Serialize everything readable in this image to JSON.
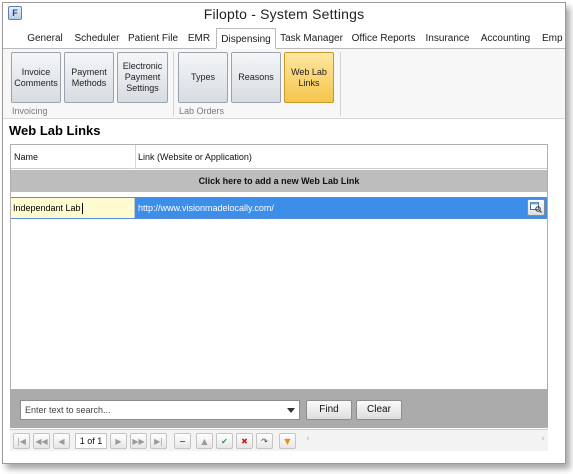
{
  "window": {
    "title": "Filopto - System Settings"
  },
  "tabs": [
    {
      "label": "General"
    },
    {
      "label": "Scheduler"
    },
    {
      "label": "Patient File"
    },
    {
      "label": "EMR"
    },
    {
      "label": "Dispensing",
      "active": true
    },
    {
      "label": "Task Manager"
    },
    {
      "label": "Office Reports"
    },
    {
      "label": "Insurance"
    },
    {
      "label": "Accounting"
    },
    {
      "label": "Emp"
    }
  ],
  "ribbon": {
    "groups": [
      {
        "label": "Invoicing",
        "buttons": [
          {
            "label": "Invoice\nComments"
          },
          {
            "label": "Payment\nMethods"
          },
          {
            "label": "Electronic\nPayment\nSettings"
          }
        ]
      },
      {
        "label": "Lab Orders",
        "buttons": [
          {
            "label": "Types"
          },
          {
            "label": "Reasons"
          },
          {
            "label": "Web Lab\nLinks",
            "active": true
          }
        ]
      }
    ]
  },
  "section": {
    "title": "Web Lab Links"
  },
  "grid": {
    "columns": [
      "Name",
      "Link (Website or Application)"
    ],
    "add_row_label": "Click here to add a new Web Lab Link",
    "rows": [
      {
        "name": "Independant Lab",
        "link": "http://www.visionmadelocally.com/"
      }
    ]
  },
  "search": {
    "placeholder": "Enter text to search...",
    "find_label": "Find",
    "clear_label": "Clear"
  },
  "navigator": {
    "page_text": "1 of 1"
  },
  "colors": {
    "selected_row": "#3d8ee8",
    "editing_cell": "#fffbd0",
    "active_ribbon": "#f5c54d"
  }
}
